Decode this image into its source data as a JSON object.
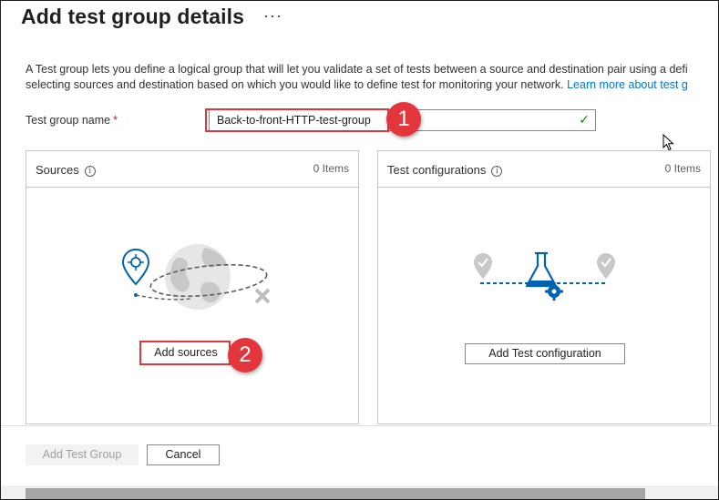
{
  "header": {
    "title": "Add test group details",
    "more_label": "···"
  },
  "description": {
    "line1": "A Test group lets you define a logical group that will let you validate a set of tests between a source and destination pair using a defi",
    "line2_text": "selecting sources and destination based on which you would like to define test for monitoring your network. ",
    "line2_link": "Learn more about test g"
  },
  "form": {
    "name_label": "Test group name",
    "required_mark": "*",
    "name_value": "Back-to-front-HTTP-test-group",
    "valid_icon": "checkmark-icon"
  },
  "callouts": {
    "one": "1",
    "two": "2"
  },
  "sources_card": {
    "title": "Sources",
    "info_icon": "info-icon",
    "count": "0 Items",
    "button": "Add sources"
  },
  "test_config_card": {
    "title": "Test configurations",
    "info_icon": "info-icon",
    "count": "0 Items",
    "button": "Add Test configuration"
  },
  "footer": {
    "primary": "Add Test Group",
    "cancel": "Cancel"
  },
  "colors": {
    "accent": "#0078d4",
    "highlight": "#e3363c",
    "valid": "#107c10"
  }
}
